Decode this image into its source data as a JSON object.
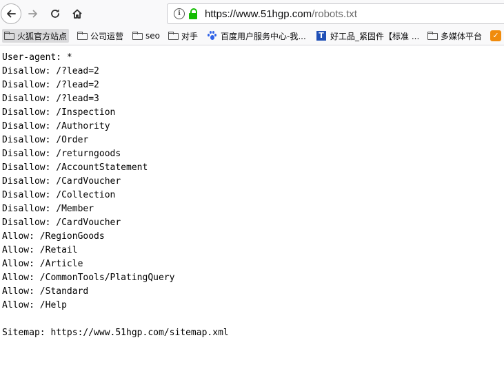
{
  "toolbar": {
    "url_host": "https://www.51hgp.com",
    "url_path": "/robots.txt"
  },
  "bookmarks": [
    {
      "label": "火狐官方站点",
      "icon": "folder-icon"
    },
    {
      "label": "公司运营",
      "icon": "folder-icon"
    },
    {
      "label": "seo",
      "icon": "folder-icon"
    },
    {
      "label": "对手",
      "icon": "folder-icon"
    },
    {
      "label": "百度用户服务中心-我...",
      "icon": "baidu-paw-icon"
    },
    {
      "label": "好工品_紧固件【标准 ...",
      "icon": "brand-icon"
    },
    {
      "label": "多媒体平台",
      "icon": "folder-icon"
    },
    {
      "label": "",
      "icon": "orange-app-icon"
    }
  ],
  "robots": {
    "lines": [
      "User-agent: *",
      "Disallow: /?lead=2",
      "Disallow: /?lead=2",
      "Disallow: /?lead=3",
      "Disallow: /Inspection",
      "Disallow: /Authority",
      "Disallow: /Order",
      "Disallow: /returngoods",
      "Disallow: /AccountStatement",
      "Disallow: /CardVoucher",
      "Disallow: /Collection",
      "Disallow: /Member",
      "Disallow: /CardVoucher",
      "Allow: /RegionGoods",
      "Allow: /Retail",
      "Allow: /Article",
      "Allow: /CommonTools/PlatingQuery",
      "Allow: /Standard",
      "Allow: /Help",
      "",
      "Sitemap: https://www.51hgp.com/sitemap.xml"
    ]
  }
}
